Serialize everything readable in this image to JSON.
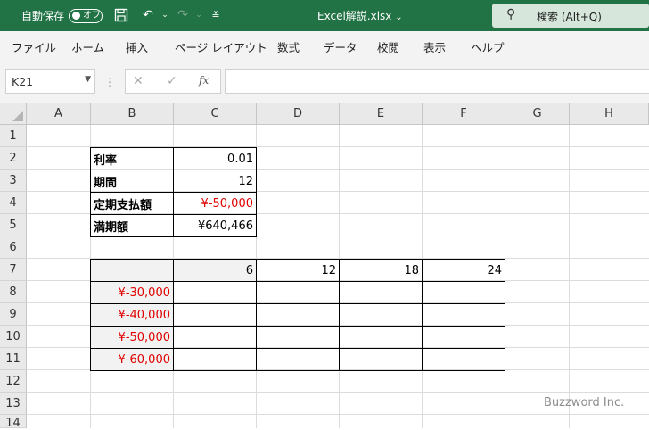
{
  "titlebar": {
    "autosave_label": "自動保存",
    "toggle_label": "オフ",
    "filename": "Excel解説.xlsx",
    "search_label": "検索 (Alt+Q)",
    "icons": [
      "save-icon",
      "undo-icon",
      "redo-icon",
      "customize-icon"
    ]
  },
  "ribbon": {
    "tabs": [
      "ファイル",
      "ホーム",
      "挿入",
      "ページ レイアウト",
      "数式",
      "データ",
      "校閲",
      "表示",
      "ヘルプ"
    ]
  },
  "formula_bar": {
    "name_box": "K21",
    "fx": "fx",
    "content": ""
  },
  "sheet": {
    "columns": [
      "A",
      "B",
      "C",
      "D",
      "E",
      "F",
      "G",
      "H"
    ],
    "rows": [
      "1",
      "2",
      "3",
      "4",
      "5",
      "6",
      "7",
      "8",
      "9",
      "10",
      "11",
      "12",
      "13",
      "14"
    ],
    "params": [
      {
        "label": "利率",
        "value": "0.01"
      },
      {
        "label": "期間",
        "value": "12"
      },
      {
        "label": "定期支払額",
        "value": "¥-50,000"
      },
      {
        "label": "満期額",
        "value": "¥640,466"
      }
    ],
    "table_header": [
      "",
      "6",
      "12",
      "18",
      "24"
    ],
    "table_rows": [
      "¥-30,000",
      "¥-40,000",
      "¥-50,000",
      "¥-60,000"
    ]
  },
  "watermark": "Buzzword Inc.",
  "colors": {
    "title_bar": "#217346",
    "negative_text": "#e00000",
    "header_bg": "#e9e9e9"
  }
}
